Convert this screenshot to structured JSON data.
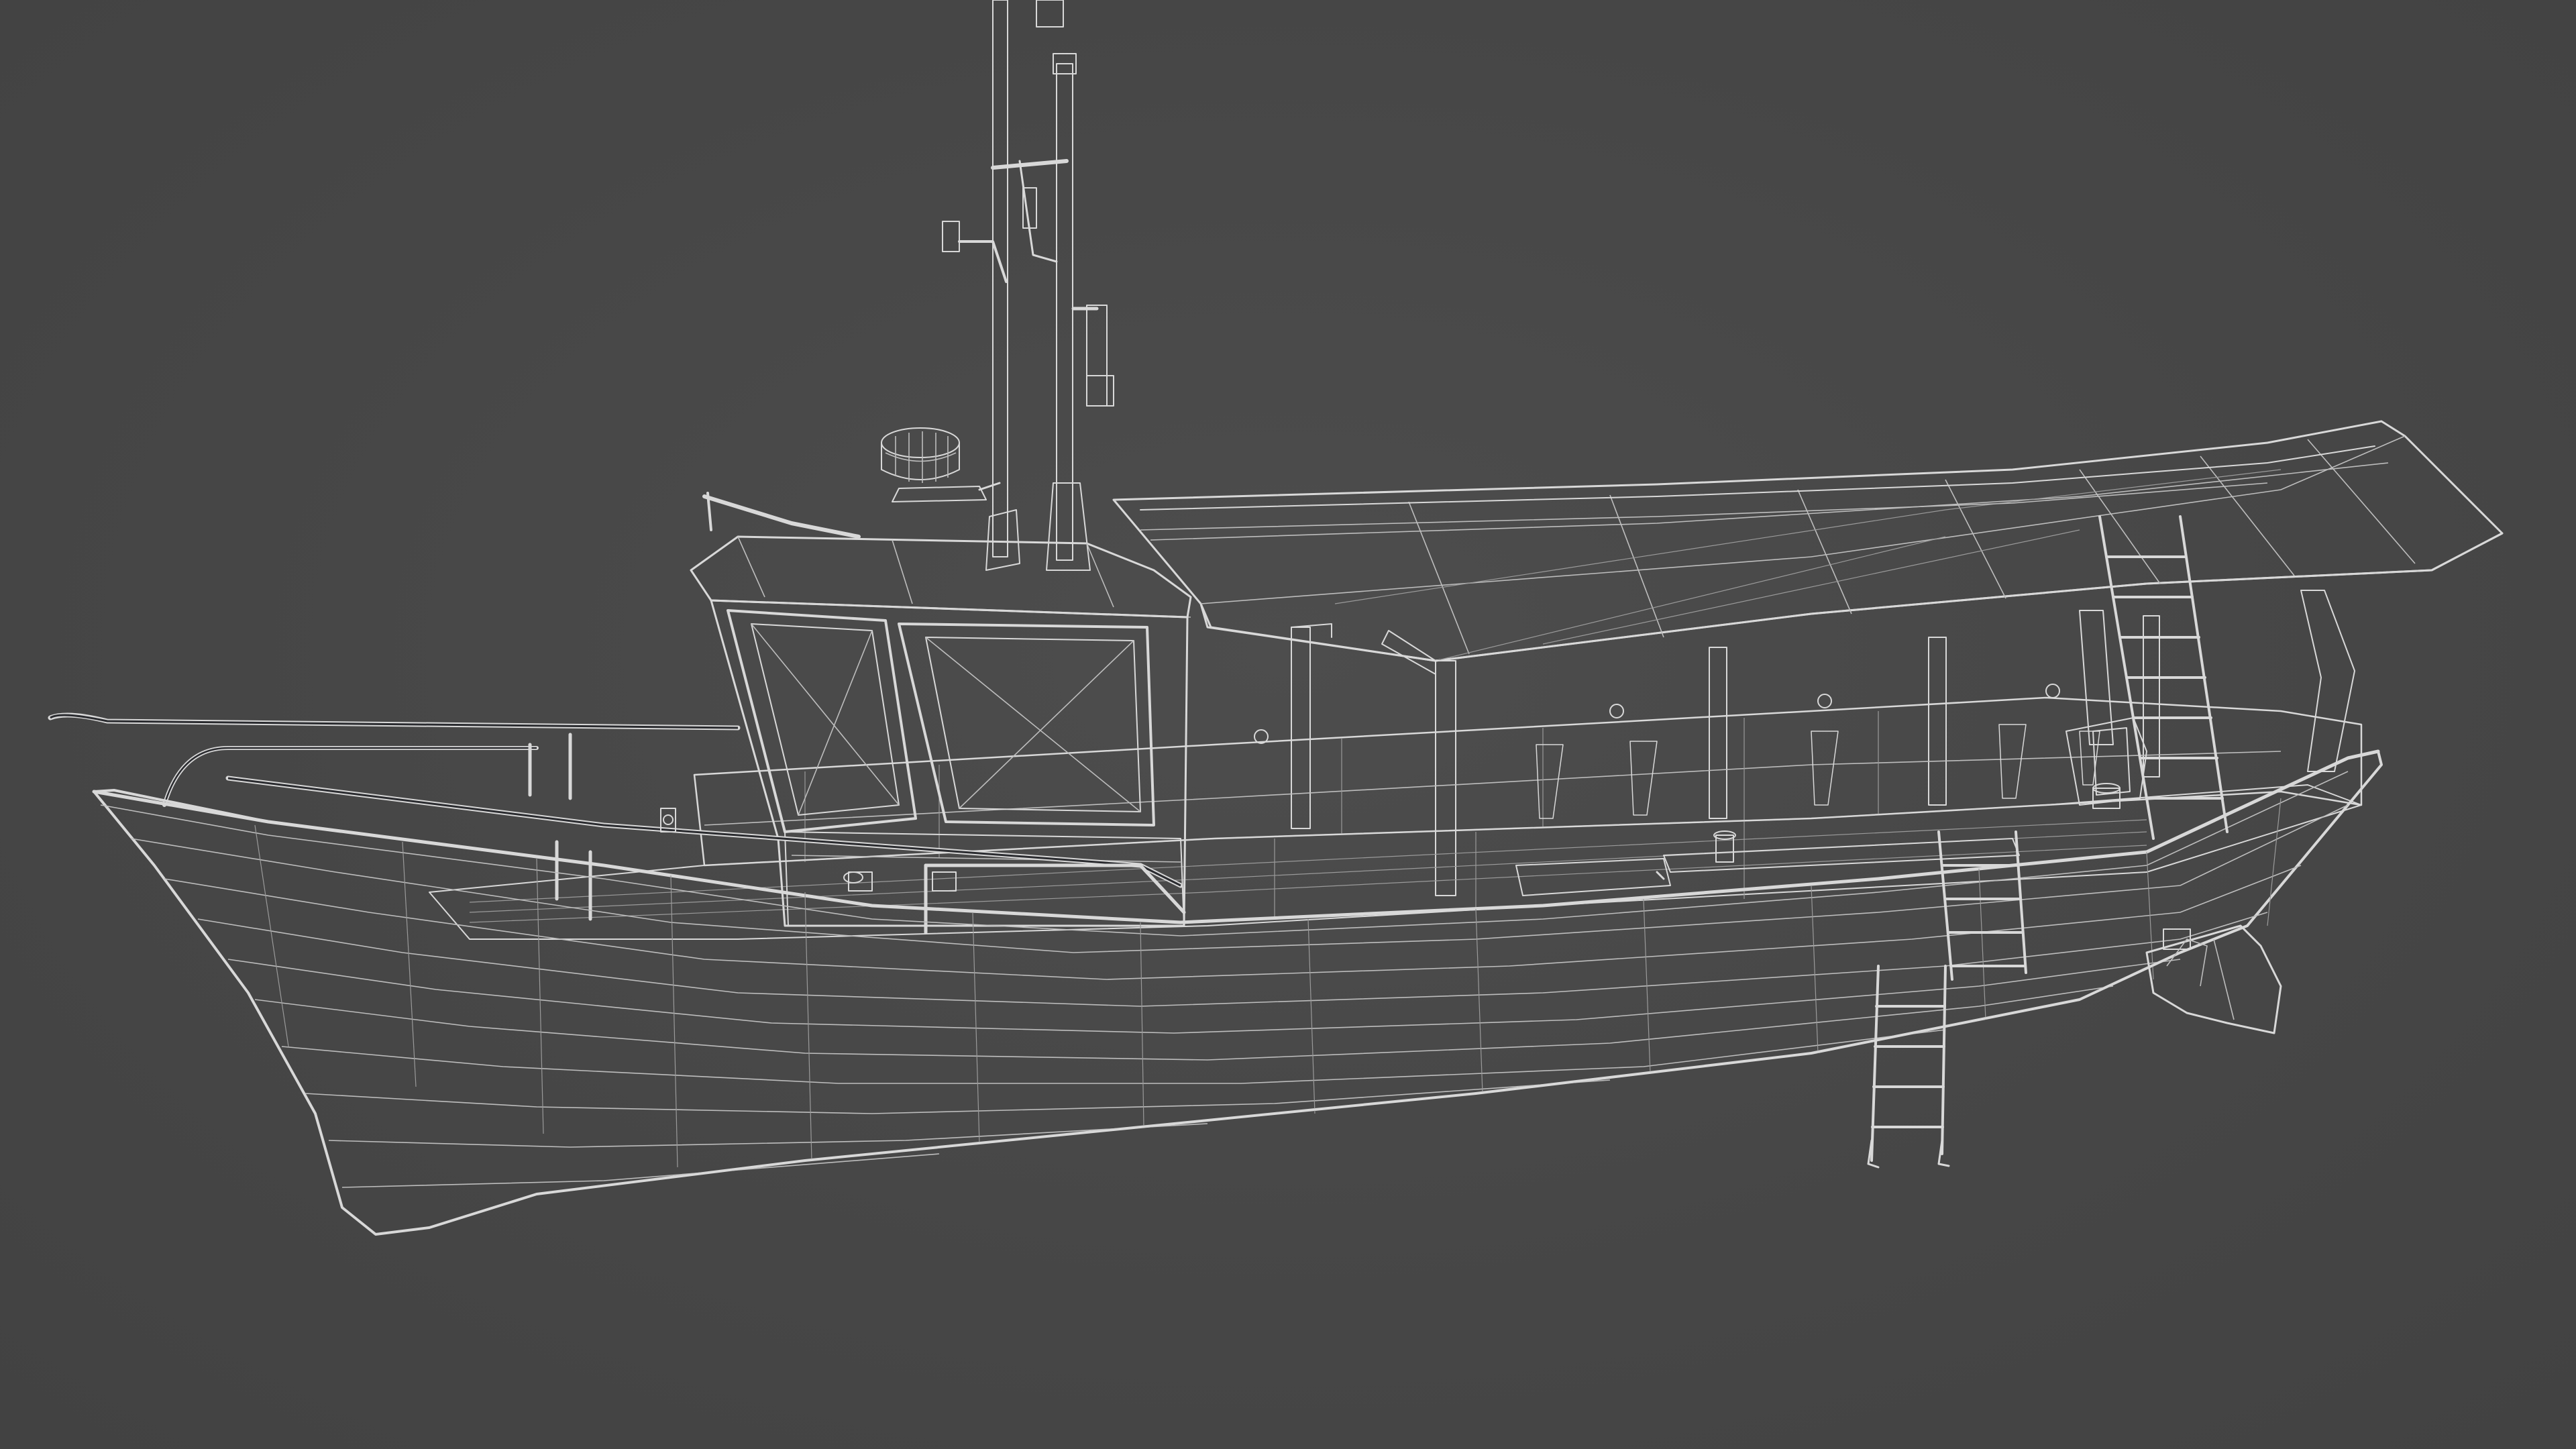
{
  "scene": {
    "subject": "boat-wireframe-model",
    "colors": {
      "background": "#474747",
      "hull": "#232528",
      "hull_shade": "#1b1c1e",
      "deck": "#8a8682",
      "canopy": "#3a2b26",
      "canopy_edge": "#4a3a33",
      "wire": "#d8d8d8",
      "cabin": "#1f2023"
    }
  }
}
